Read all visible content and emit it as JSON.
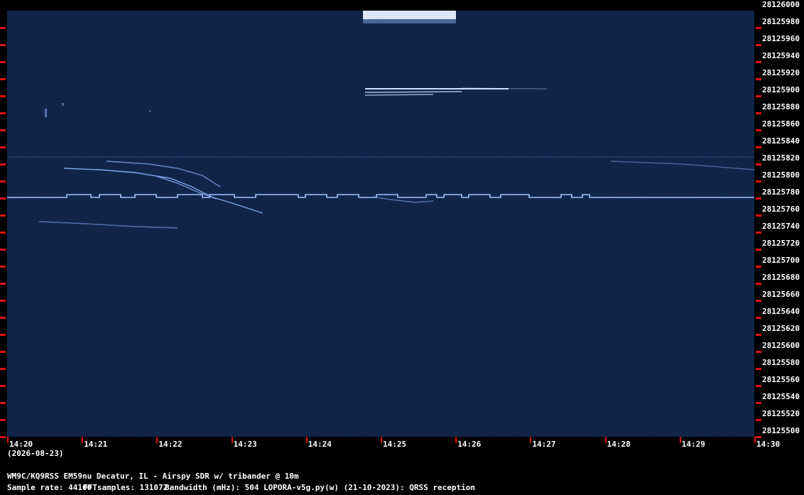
{
  "frequency_labels": [
    "28126000",
    "28125980",
    "28125960",
    "28125940",
    "28125920",
    "28125900",
    "28125880",
    "28125860",
    "28125840",
    "28125820",
    "28125800",
    "28125780",
    "28125760",
    "28125740",
    "28125720",
    "28125700",
    "28125680",
    "28125660",
    "28125640",
    "28125620",
    "28125600",
    "28125580",
    "28125560",
    "28125540",
    "28125520",
    "28125500"
  ],
  "time_labels": [
    "14:20",
    "14:21",
    "14:22",
    "14:23",
    "14:24",
    "14:25",
    "14:26",
    "14:27",
    "14:28",
    "14:29",
    "14:30"
  ],
  "date": "(2026-08-23)",
  "station": "WM9C/KQ9RSS EM59nu Decatur, IL - Airspy SDR w/ tribander @ 10m",
  "sample_rate": "Sample rate: 44100",
  "fft_samples": "FFTsamples: 131072",
  "bandwidth": "Bandwidth (mHz): 504",
  "software": "LOPORA-v5g.py(w) (21-10-2023): QRSS reception",
  "colors": {
    "background": "#0b1636",
    "tick": "#dd1111",
    "signal": "#9fc4ff"
  }
}
